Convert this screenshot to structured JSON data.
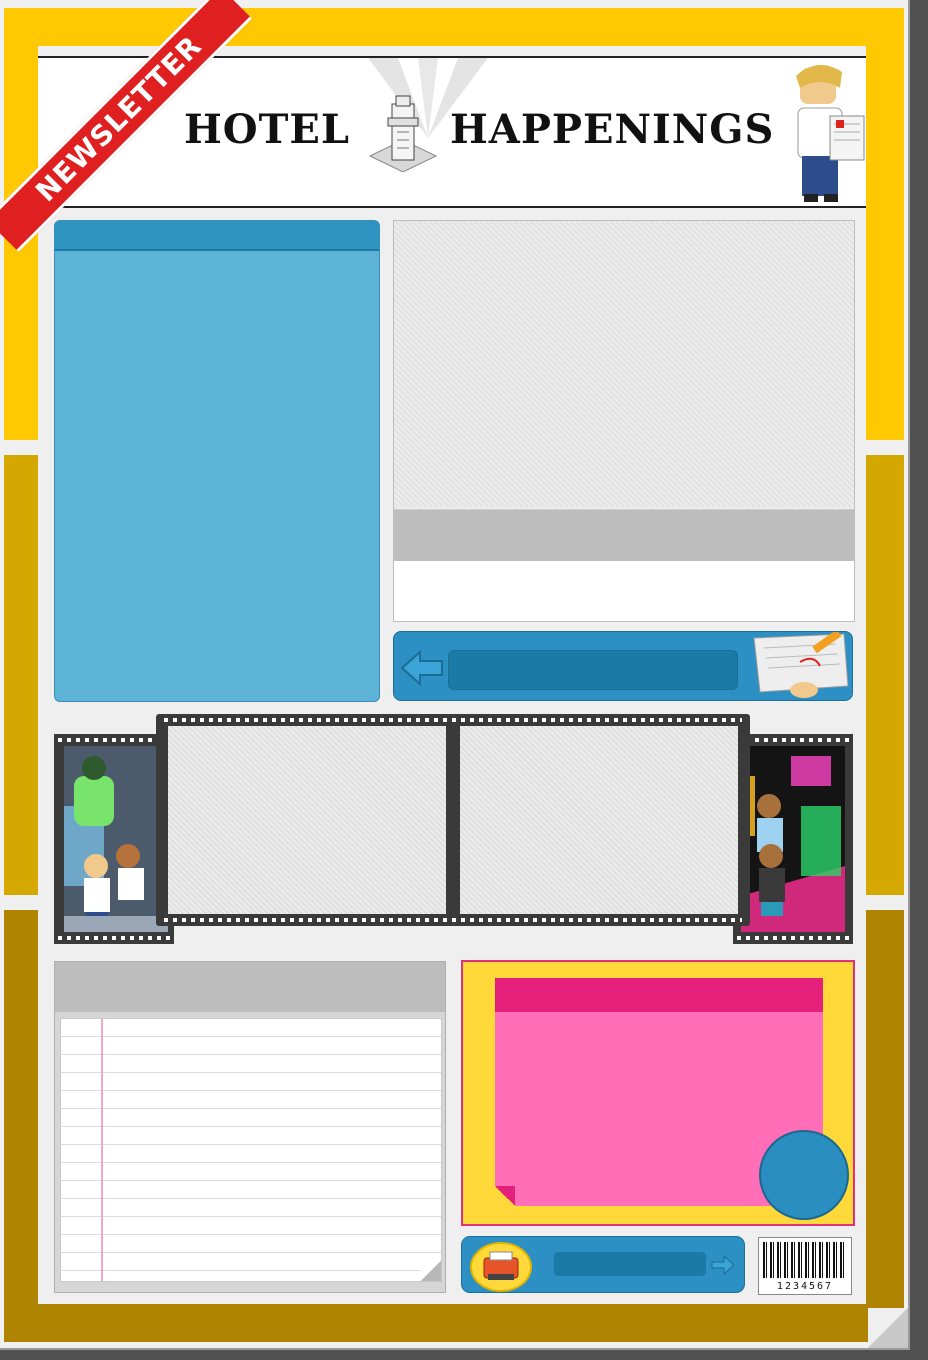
{
  "header": {
    "word_left": "HOTEL",
    "word_right": "HAPPENINGS",
    "ribbon": "NEWSLETTER"
  },
  "barcode": {
    "number": "1234567"
  },
  "colors": {
    "band_top": "#ffc800",
    "band_mid": "#d4a800",
    "band_bottom": "#ae8400",
    "panel_blue": "#5cb3d6",
    "nav_blue": "#2c90c4",
    "sticky_pink": "#ff6eb7",
    "sticky_pink_head": "#e5207a",
    "sticky_frame_yellow": "#ffd93a",
    "ribbon_red": "#e02020"
  },
  "icons": [
    "hotel-tower-icon",
    "back-arrow-icon",
    "pencil-note-icon",
    "typewriter-icon",
    "forward-arrow-icon",
    "page-curl-icon"
  ]
}
